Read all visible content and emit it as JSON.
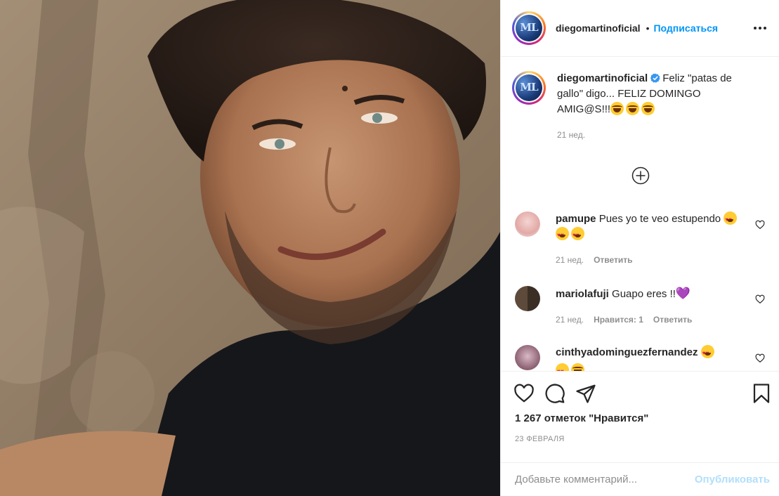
{
  "post": {
    "author": {
      "username": "diegomartinoficial",
      "follow_label": "Подписаться",
      "separator": "•"
    },
    "caption": {
      "username": "diegomartinoficial",
      "text": "Feliz \"patas de gallo\" digo... FELIZ DOMINGO AMIG@S!!!",
      "emoji_count": 3,
      "time": "21 нед."
    },
    "comments": [
      {
        "username": "pamupe",
        "text": "Pues yo te veo estupendo",
        "time": "21 нед.",
        "reply_label": "Ответить",
        "likes_label": ""
      },
      {
        "username": "mariolafuji",
        "text": "Guapo eres !!",
        "extra": "💜",
        "time": "21 нед.",
        "likes_label": "Нравится: 1",
        "reply_label": "Ответить"
      },
      {
        "username": "cinthyadominguezfernandez",
        "text": ""
      }
    ],
    "likes_text": "1 267 отметок \"Нравится\"",
    "date": "23 ФЕВРАЛЯ",
    "comment_box": {
      "placeholder": "Добавьте комментарий...",
      "publish_label": "Опубликовать"
    }
  },
  "colors": {
    "link_blue": "#0095f6",
    "publish_disabled": "#b2dffc",
    "muted": "#8e8e8e",
    "border": "#efefef"
  },
  "icons": [
    "verified-badge-icon",
    "more-options-icon",
    "load-more-comments-icon",
    "like-icon",
    "comment-icon",
    "share-icon",
    "save-icon",
    "comment-like-icon"
  ]
}
